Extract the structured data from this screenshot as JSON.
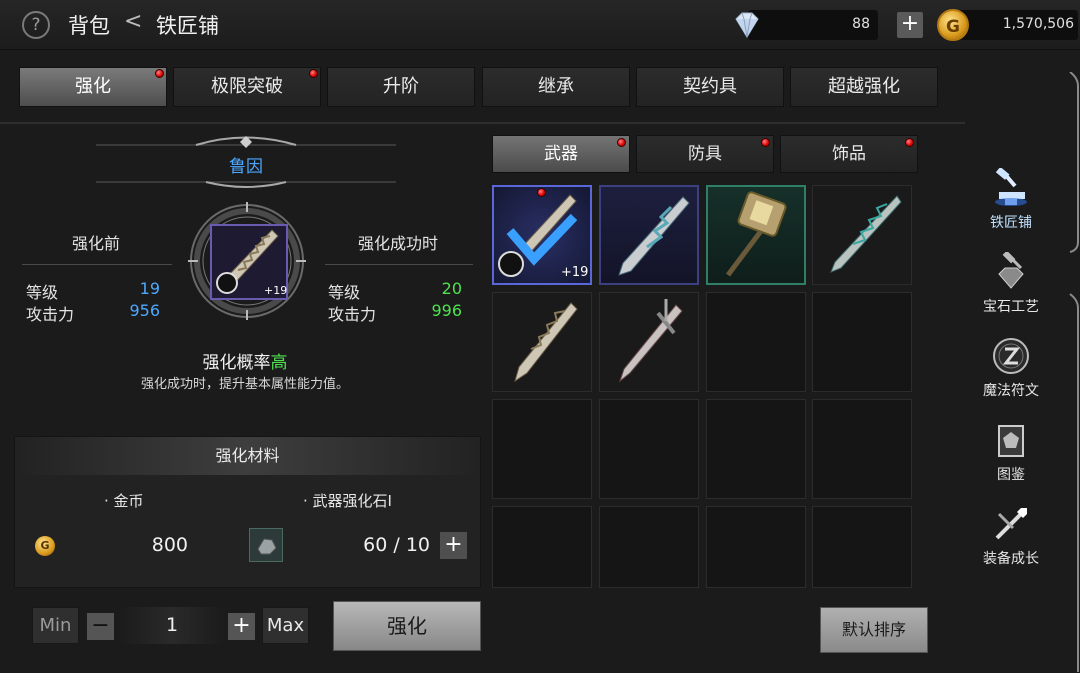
{
  "header": {
    "help_glyph": "?",
    "crumb_bag": "背包",
    "crumb_sep": "<",
    "crumb_current": "铁匠铺",
    "gems": "88",
    "gold": "1,570,506",
    "gold_glyph": "G",
    "add_glyph": "+"
  },
  "main_tabs": [
    {
      "label": "强化",
      "dot": true
    },
    {
      "label": "极限突破",
      "dot": true
    },
    {
      "label": "升阶",
      "dot": false
    },
    {
      "label": "继承",
      "dot": false
    },
    {
      "label": "契约具",
      "dot": false
    },
    {
      "label": "超越强化",
      "dot": false
    }
  ],
  "enhance": {
    "character": "鲁因",
    "before_label": "强化前",
    "after_label": "强化成功时",
    "level_label": "等级",
    "atk_label": "攻击力",
    "before_level": "19",
    "before_atk": "956",
    "after_level": "20",
    "after_atk": "996",
    "item_plus": "+19",
    "rate_label": "强化概率",
    "rate_value": "高",
    "rate_desc": "强化成功时，提升基本属性能力值。"
  },
  "materials": {
    "title": "强化材料",
    "gold_name": "· 金币",
    "gold_cost": "800",
    "stone_name": "· 武器强化石I",
    "stone_count": "60 / 10",
    "coin_glyph": "G",
    "add_glyph": "+"
  },
  "controls": {
    "min": "Min",
    "minus": "−",
    "qty": "1",
    "plus": "+",
    "max": "Max",
    "enhance": "强化"
  },
  "sub_tabs": [
    {
      "label": "武器",
      "dot": true
    },
    {
      "label": "防具",
      "dot": true
    },
    {
      "label": "饰品",
      "dot": true
    }
  ],
  "inventory": {
    "selected_plus": "+19",
    "sort_label": "默认排序"
  },
  "side_nav": [
    {
      "label": "铁匠铺",
      "icon": "anvil-hammer-icon",
      "active": true
    },
    {
      "label": "宝石工艺",
      "icon": "gem-hammer-icon",
      "active": false
    },
    {
      "label": "魔法符文",
      "icon": "rune-icon",
      "active": false
    },
    {
      "label": "图鉴",
      "icon": "book-icon",
      "active": false
    },
    {
      "label": "装备成长",
      "icon": "sword-arrow-icon",
      "active": false
    }
  ],
  "colors": {
    "accent_blue": "#4da8ff",
    "stat_green": "#4fe24f",
    "notify_red": "#e00000",
    "gold": "#d99a1c"
  }
}
